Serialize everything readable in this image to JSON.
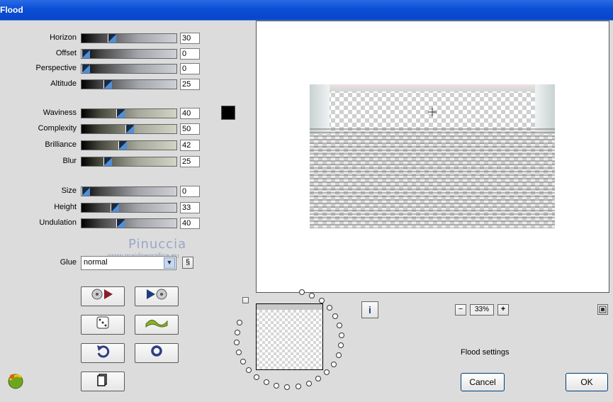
{
  "window": {
    "title": "Flood"
  },
  "controls": [
    {
      "label": "Horizon",
      "value": "30",
      "level": 0.3
    },
    {
      "label": "Offset",
      "value": "0",
      "level": 0
    },
    {
      "label": "Perspective",
      "value": "0",
      "level": 0
    },
    {
      "label": "Altitude",
      "value": "25",
      "level": 0.25
    },
    {
      "label": "Waviness",
      "value": "40",
      "level": 0.4
    },
    {
      "label": "Complexity",
      "value": "50",
      "level": 0.5
    },
    {
      "label": "Brilliance",
      "value": "42",
      "level": 0.42
    },
    {
      "label": "Blur",
      "value": "25",
      "level": 0.25
    },
    {
      "label": "Size",
      "value": "0",
      "level": 0
    },
    {
      "label": "Height",
      "value": "33",
      "level": 0.33
    },
    {
      "label": "Undulation",
      "value": "40",
      "level": 0.4
    }
  ],
  "color_swatch": "#000000",
  "glue": {
    "label": "Glue",
    "selected": "normal"
  },
  "watermark": {
    "name": "Pinuccia",
    "url": "www.maidiregrafica.eu"
  },
  "toolbar_icons": [
    "load-preset-icon",
    "save-preset-icon",
    "random-dice-icon",
    "wave-icon",
    "undo-icon",
    "reset-icon",
    "copy-icon"
  ],
  "zoom": {
    "minus": "−",
    "value": "33%",
    "plus": "+"
  },
  "info_icon": "i",
  "status": "Flood settings",
  "buttons": {
    "cancel": "Cancel",
    "ok": "OK"
  }
}
